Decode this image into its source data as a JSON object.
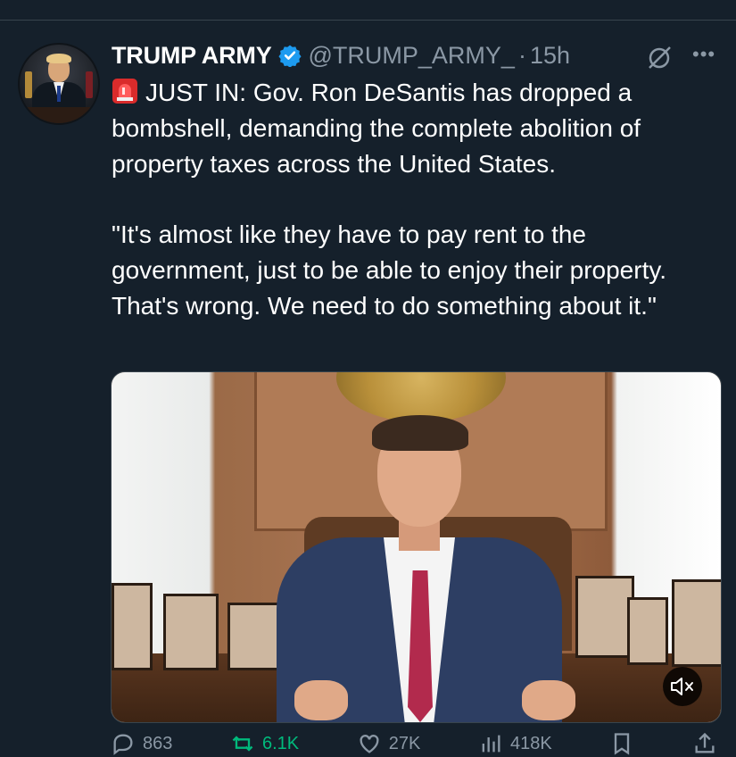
{
  "author": {
    "name": "TRUMP ARMY",
    "handle": "@TRUMP_ARMY_",
    "separator": "·",
    "time": "15h",
    "verified": true
  },
  "tweet": {
    "line1": "JUST IN: Gov. Ron DeSantis has dropped a bombshell, demanding the complete abolition of property taxes across the United States.",
    "quote": "\"It's almost like they have to pay rent to the government, just to be able to enjoy their property. That's wrong. We need to do something about it.\""
  },
  "media": {
    "kind": "video",
    "muted": true
  },
  "actions": {
    "replies": "863",
    "retweets": "6.1K",
    "likes": "27K",
    "views": "418K"
  },
  "icons": {
    "verified": "verified-badge-icon",
    "siren": "siren-emoji-icon",
    "grok": "grok-icon",
    "more": "more-icon",
    "reply": "reply-icon",
    "retweet": "retweet-icon",
    "like": "like-icon",
    "views": "views-icon",
    "bookmark": "bookmark-icon",
    "share": "share-icon",
    "mute": "mute-icon"
  },
  "colors": {
    "background": "#15202b",
    "accent": "#1d9bf0",
    "secondary_text": "#8b98a5",
    "retweet_green": "#00ba7c"
  }
}
